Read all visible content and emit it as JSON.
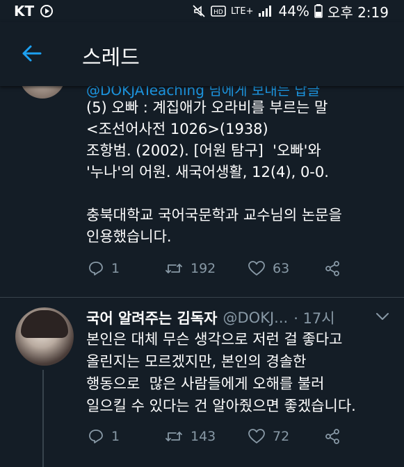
{
  "status_bar": {
    "carrier": "KT",
    "network": "LTE+",
    "battery": "44%",
    "time": "오후 2:19"
  },
  "app_bar": {
    "title": "스레드"
  },
  "prev_tweet": {
    "handle_partial": "@DOKJATeaching 님에게 보내는 답글",
    "text": "(5) 오빠 : 계집애가 오라비를 부르는 말\n<조선어사전 1026>(1938)\n조항범. (2002). [어원 탐구]  '오빠'와\n'누나'의 어원. 새국어생활, 12(4), 0-0.\n\n충북대학교 국어국문학과 교수님의 논문을\n인용했습니다.",
    "replies": "1",
    "retweets": "192",
    "likes": "63"
  },
  "reply_tweet": {
    "name": "국어 알려주는 김독자",
    "handle": "@DOKJ...",
    "time": "· 17시",
    "text": "본인은 대체 무슨 생각으로 저런 걸 좋다고\n올린지는 모르겠지만, 본인의 경솔한\n행동으로  많은 사람들에게 오해를 불러\n일으킬 수 있다는 건 알아줬으면 좋겠습니다.",
    "replies": "1",
    "retweets": "143",
    "likes": "72"
  },
  "colors": {
    "background": "#141d26",
    "accent": "#1da1f2",
    "muted": "#8899a6",
    "divider": "#38444d"
  }
}
